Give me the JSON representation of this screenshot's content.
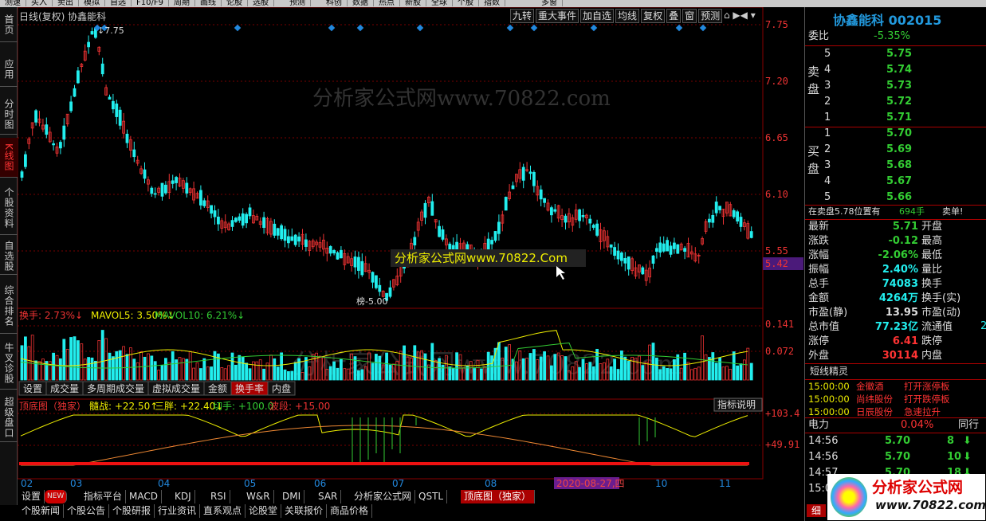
{
  "menubar": [
    "测速",
    "买入",
    "卖出",
    "模拟",
    "自选",
    "F10/F9",
    "周期",
    "画线",
    "论股",
    "选股",
    "",
    "预测",
    "",
    "科创",
    "数据",
    "热点",
    "新股",
    "全球",
    "个股",
    "指数",
    "",
    "",
    "",
    "多窗"
  ],
  "left_tabs": [
    "首页",
    "应用",
    "分时图",
    "K线图",
    "个股资料",
    "自选股",
    "综合排名",
    "牛叉诊股",
    "超级盘口"
  ],
  "chart": {
    "title": "日线(复权) 协鑫能科",
    "toolbar": [
      "九转",
      "重大事件",
      "加自选",
      "均线",
      "复权",
      "叠",
      "窗",
      "预测"
    ],
    "price_axis": [
      "7.75",
      "7.20",
      "6.65",
      "6.10",
      "5.55",
      "5.42"
    ],
    "high_label": "7.75",
    "low_label": "5.00",
    "low_marker": "榜",
    "watermark": "分析家公式网www.70822.com",
    "ad_label": "分析家公式网www.70822.Com",
    "vol_legend": {
      "a": "换手: 2.73%↓",
      "b": "MAVOL5: 3.50%↓",
      "c": "MAVOL10: 6.21%↓"
    },
    "vol_axis": [
      "0.141",
      "0.072"
    ],
    "vol_tabs": [
      "设置",
      "成交量",
      "多周期成交量",
      "虚拟成交量",
      "金额",
      "换手率",
      "内盘"
    ],
    "ind_legend": {
      "name": "顶底图（独家）",
      "a": "髓战: +22.50↑",
      "b": "三胖: +22.40↓",
      "c": "切手: +100.0",
      "d": "波段: +15.00"
    },
    "ind_help": "指标说明",
    "ind_axis": [
      "+103.4",
      "+49.91"
    ],
    "x_labels": [
      "02",
      "03",
      "04",
      "05",
      "06",
      "07",
      "08",
      "09",
      "10",
      "11"
    ],
    "cursor_date": "2020-08-27,四",
    "bottom_tabs": [
      "设置",
      "NEW",
      "指标平台",
      "MACD",
      "KDJ",
      "RSI",
      "W&R",
      "DMI",
      "SAR",
      "分析家公式网",
      "QSTL",
      "顶底图（独家）"
    ],
    "bottom_tabs2": [
      "个股新闻",
      "个股公告",
      "个股研报",
      "行业资讯",
      "直系观点",
      "论股堂",
      "关联报价",
      "商品价格"
    ],
    "colors": {
      "up": "#e33",
      "down": "#2ee",
      "ma5": "#ee0",
      "ma10": "#3c3",
      "accent": "#2288dd"
    }
  },
  "panel": {
    "stock": "协鑫能科 002015",
    "weibi_label": "委比",
    "weibi": "-5.35%",
    "sell_label": [
      "卖",
      "盘"
    ],
    "buy_label": [
      "买",
      "盘"
    ],
    "sell": [
      {
        "n": "5",
        "p": "5.75"
      },
      {
        "n": "4",
        "p": "5.74"
      },
      {
        "n": "3",
        "p": "5.73"
      },
      {
        "n": "2",
        "p": "5.72"
      },
      {
        "n": "1",
        "p": "5.71"
      }
    ],
    "buy": [
      {
        "n": "1",
        "p": "5.70"
      },
      {
        "n": "2",
        "p": "5.69"
      },
      {
        "n": "3",
        "p": "5.68"
      },
      {
        "n": "4",
        "p": "5.67"
      },
      {
        "n": "5",
        "p": "5.66"
      }
    ],
    "notice": "在卖盘5.78位置有",
    "notice_vol": "694手",
    "notice_tail": "卖单!",
    "stats": [
      {
        "l": "最新",
        "v": "5.71",
        "l2": "开盘",
        "c": "grn"
      },
      {
        "l": "涨跌",
        "v": "-0.12",
        "l2": "最高",
        "c": "grn"
      },
      {
        "l": "涨幅",
        "v": "-2.06%",
        "l2": "最低",
        "c": "grn"
      },
      {
        "l": "振幅",
        "v": "2.40%",
        "l2": "量比",
        "c": "cyn"
      },
      {
        "l": "总手",
        "v": "74083",
        "l2": "换手",
        "c": "cyn"
      },
      {
        "l": "金额",
        "v": "4264万",
        "l2": "换手(实)",
        "c": "cyn"
      },
      {
        "l": "市盈(静)",
        "v": "13.95",
        "l2": "市盈(动)",
        "c": "wht"
      },
      {
        "l": "总市值",
        "v": "77.23亿",
        "l2": "流通值",
        "c": "cyn"
      },
      {
        "l": "涨停",
        "v": "6.41",
        "l2": "跌停",
        "c": "red"
      },
      {
        "l": "外盘",
        "v": "30114",
        "l2": "内盘",
        "c": "red"
      }
    ],
    "stats_extra": "22",
    "jingling_title": "短线精灵",
    "jingling": [
      {
        "t": "15:00:00",
        "s": "金徽酒",
        "e": "打开涨停板"
      },
      {
        "t": "15:00:00",
        "s": "尚纬股份",
        "e": "打开跌停板"
      },
      {
        "t": "15:00:00",
        "s": "日辰股份",
        "e": "急速拉升"
      }
    ],
    "sector": "电力",
    "sector_pct": "0.04%",
    "sector_tail": "同行",
    "ticks": [
      {
        "t": "14:56",
        "p": "5.70",
        "v": "8"
      },
      {
        "t": "14:56",
        "p": "5.70",
        "v": "10"
      },
      {
        "t": "14:57",
        "p": "5.70",
        "v": "18"
      },
      {
        "t": "15:00",
        "p": "",
        "v": ""
      }
    ],
    "logo": "分析家公式网",
    "logo_url": "www.70822.com",
    "bottom_tab": "细"
  }
}
